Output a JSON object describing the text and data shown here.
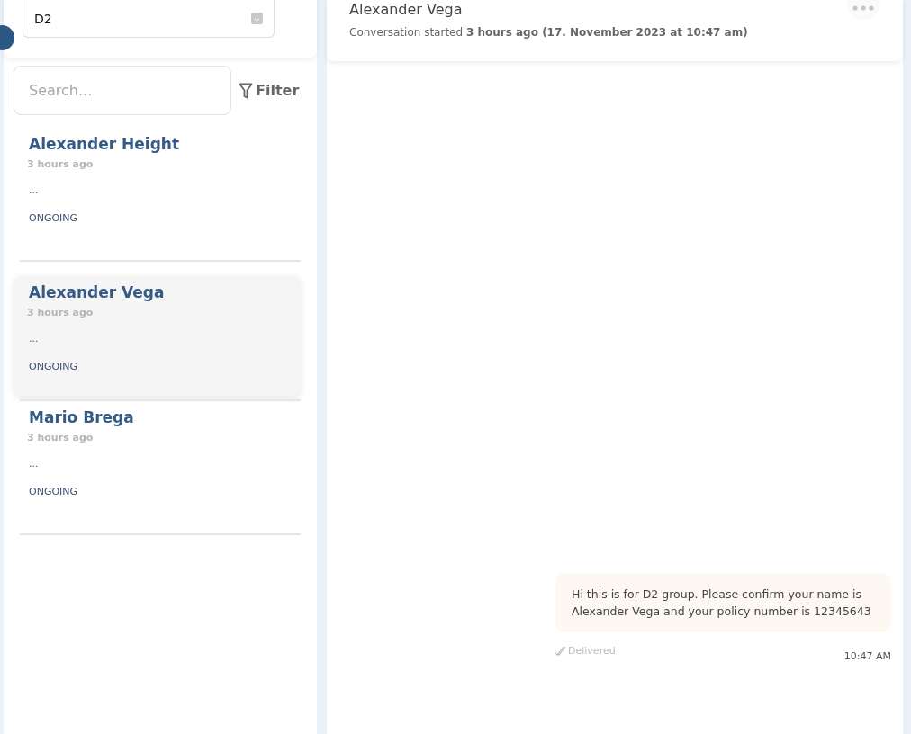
{
  "group_select": {
    "value": "D2"
  },
  "search": {
    "placeholder": "Search..."
  },
  "filter_label": "Filter",
  "conversations": [
    {
      "name": "Alexander Height",
      "time": "3 hours ago",
      "preview": "...",
      "status": "ONGOING",
      "selected": false
    },
    {
      "name": "Alexander Vega",
      "time": "3 hours ago",
      "preview": "...",
      "status": "ONGOING",
      "selected": true
    },
    {
      "name": "Mario Brega",
      "time": "3 hours ago",
      "preview": "...",
      "status": "ONGOING",
      "selected": false
    }
  ],
  "chat": {
    "title": "Alexander Vega",
    "subtitle": "Conversation started **3 hours ago (17. November 2023 at 10:47 am)**"
  },
  "messages": [
    {
      "text": "Hi this is for D2 group. Please confirm your name is Alexander Vega and your policy number is 12345643",
      "status": "Delivered",
      "time": "10:47 AM"
    }
  ]
}
